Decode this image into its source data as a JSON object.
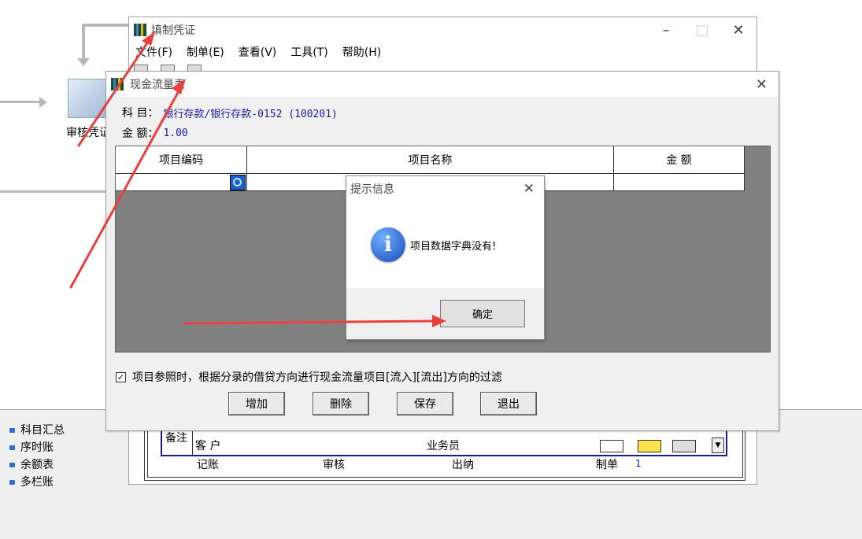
{
  "background": {
    "audit_label": "审核凭证",
    "side_items": [
      "科目汇总",
      "序时账",
      "余额表",
      "多栏账"
    ]
  },
  "voucher_window": {
    "title": "填制凭证",
    "menu": [
      "文件(F)",
      "制单(E)",
      "查看(V)",
      "工具(T)",
      "帮助(H)"
    ],
    "remark_label": "备注",
    "customer_label": "客 户",
    "salesperson_label": "业务员",
    "footer": {
      "post_label": "记账",
      "review_label": "审核",
      "cashier_label": "出纳",
      "maker_label": "制单",
      "maker_value": "1"
    }
  },
  "cash_flow_dialog": {
    "title": "现金流量表",
    "subject_label": "科 目：",
    "subject_value": "银行存款/银行存款-0152 (100201)",
    "amount_label": "金 额：",
    "amount_value": "1.00",
    "columns": [
      "项目编码",
      "项目名称",
      "金 额"
    ],
    "filter_checkbox_label": "项目参照时，根据分录的借贷方向进行现金流量项目[流入][流出]方向的过滤",
    "filter_checked": true,
    "buttons": {
      "add": "增加",
      "delete": "删除",
      "save": "保存",
      "exit": "退出"
    }
  },
  "message_box": {
    "title": "提示信息",
    "message": "项目数据字典没有!",
    "ok_label": "确定",
    "icon": "info-icon"
  },
  "colors": {
    "annotation_arrow": "#e8413b",
    "field_value_blue": "#1a1aa8",
    "grid_gray": "#808080"
  }
}
